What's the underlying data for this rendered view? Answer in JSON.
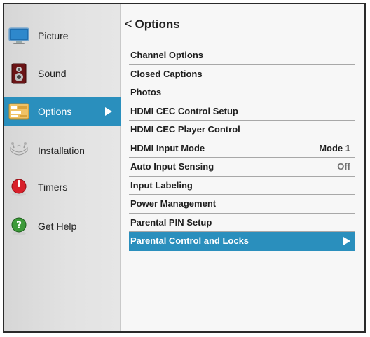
{
  "sidebar": {
    "items": [
      {
        "label": "Picture",
        "icon": "monitor-icon"
      },
      {
        "label": "Sound",
        "icon": "speaker-icon"
      },
      {
        "label": "Options",
        "icon": "options-icon",
        "selected": true
      },
      {
        "label": "Installation",
        "icon": "satellite-dish-icon"
      },
      {
        "label": "Timers",
        "icon": "timer-icon"
      },
      {
        "label": "Get Help",
        "icon": "help-icon"
      }
    ]
  },
  "main": {
    "title": "Options",
    "back_glyph": "<",
    "items": [
      {
        "label": "Channel Options",
        "value": ""
      },
      {
        "label": "Closed Captions",
        "value": ""
      },
      {
        "label": "Photos",
        "value": ""
      },
      {
        "label": "HDMI CEC Control Setup",
        "value": ""
      },
      {
        "label": "HDMI CEC Player Control",
        "value": ""
      },
      {
        "label": "HDMI Input Mode",
        "value": "Mode 1"
      },
      {
        "label": "Auto Input Sensing",
        "value": "Off"
      },
      {
        "label": "Input Labeling",
        "value": ""
      },
      {
        "label": "Power Management",
        "value": ""
      },
      {
        "label": "Parental PIN Setup",
        "value": ""
      },
      {
        "label": "Parental Control and Locks",
        "value": "",
        "selected": true
      }
    ]
  },
  "colors": {
    "accent": "#2a8fbd",
    "sidebar_bg": "#dcdcdc",
    "main_bg": "#f7f7f7",
    "divider": "#a8a8a8"
  }
}
